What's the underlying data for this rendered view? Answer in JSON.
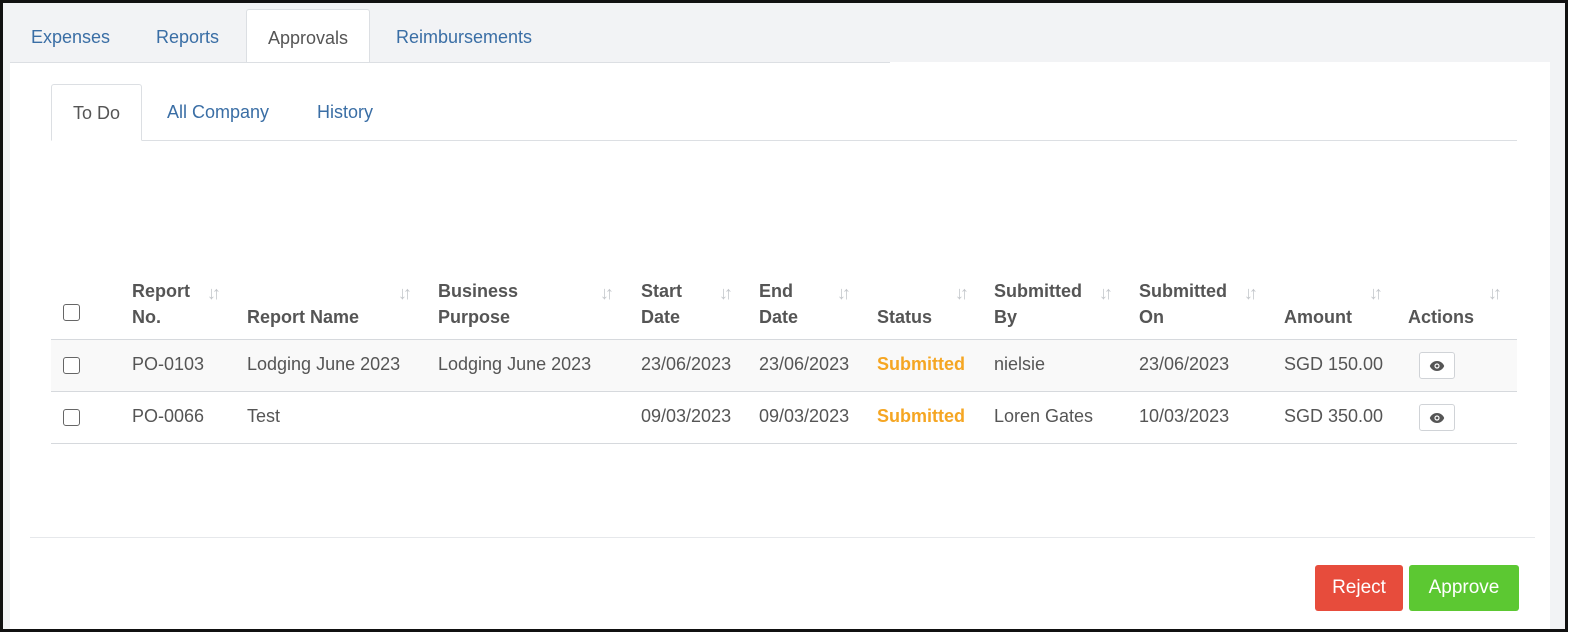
{
  "top_tabs": [
    {
      "label": "Expenses",
      "active": false
    },
    {
      "label": "Reports",
      "active": false
    },
    {
      "label": "Approvals",
      "active": true
    },
    {
      "label": "Reimbursements",
      "active": false
    }
  ],
  "sub_tabs": [
    {
      "label": "To Do",
      "active": true
    },
    {
      "label": "All Company",
      "active": false
    },
    {
      "label": "History",
      "active": false
    }
  ],
  "table": {
    "columns": [
      {
        "key": "report_no",
        "label": "Report\nNo."
      },
      {
        "key": "report_name",
        "label": "Report Name"
      },
      {
        "key": "business_purpose",
        "label": "Business\nPurpose"
      },
      {
        "key": "start_date",
        "label": "Start\nDate"
      },
      {
        "key": "end_date",
        "label": "End\nDate"
      },
      {
        "key": "status",
        "label": "Status"
      },
      {
        "key": "submitted_by",
        "label": "Submitted\nBy"
      },
      {
        "key": "submitted_on",
        "label": "Submitted\nOn"
      },
      {
        "key": "amount",
        "label": "Amount"
      },
      {
        "key": "actions",
        "label": "Actions"
      }
    ],
    "rows": [
      {
        "report_no": "PO-0103",
        "report_name": "Lodging June 2023",
        "business_purpose": "Lodging June 2023",
        "start_date": "23/06/2023",
        "end_date": "23/06/2023",
        "status": "Submitted",
        "submitted_by": "nielsie",
        "submitted_on": "23/06/2023",
        "amount": "SGD 150.00"
      },
      {
        "report_no": "PO-0066",
        "report_name": "Test",
        "business_purpose": "",
        "start_date": "09/03/2023",
        "end_date": "09/03/2023",
        "status": "Submitted",
        "submitted_by": "Loren Gates",
        "submitted_on": "10/03/2023",
        "amount": "SGD 350.00"
      }
    ]
  },
  "icons": {
    "sort": "sort-icon",
    "view": "eye-icon"
  },
  "colors": {
    "status_submitted": "#f5a623",
    "reject": "#e74c3c",
    "approve": "#5cc832",
    "link": "#3a6ea5"
  },
  "buttons": {
    "reject": "Reject",
    "approve": "Approve"
  }
}
